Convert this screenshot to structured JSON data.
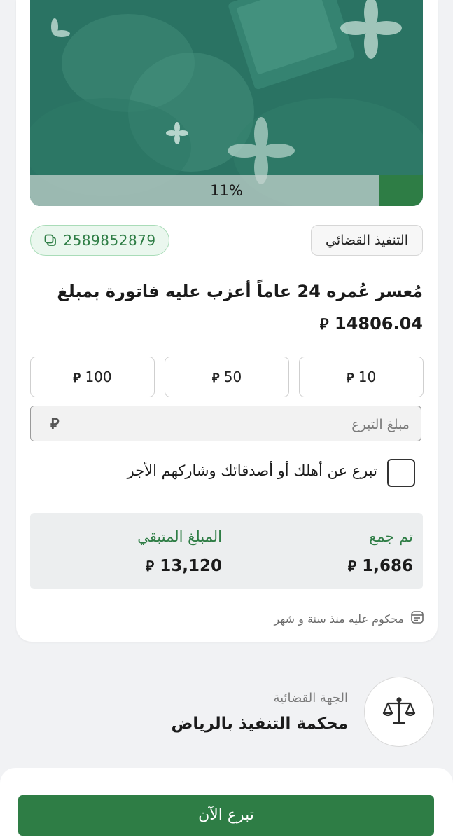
{
  "hero": {
    "progress_percent": 11,
    "progress_label": "11%"
  },
  "case": {
    "category": "التنفيذ القضائي",
    "id": "2589852879",
    "title": "مُعسر عُمره 24 عاماً أعزب عليه فاتورة بمبلغ",
    "amount": "14806.04",
    "currency_symbol": "⃁"
  },
  "quick_amounts": [
    {
      "label": "10"
    },
    {
      "label": "50"
    },
    {
      "label": "100"
    }
  ],
  "donation_input": {
    "placeholder": "مبلغ التبرع"
  },
  "gift_option": {
    "label": "تبرع عن أهلك أو أصدقائك وشاركهم الأجر",
    "checked": false
  },
  "stats": {
    "collected_label": "تم جمع",
    "collected_value": "1,686",
    "remaining_label": "المبلغ المتبقي",
    "remaining_value": "13,120"
  },
  "meta": {
    "sentence_text": "محكوم عليه منذ سنة و شهر",
    "icon": "document-icon"
  },
  "authority": {
    "caption": "الجهة القضائية",
    "name": "محكمة التنفيذ بالرياض",
    "icon": "scales-icon"
  },
  "cta": {
    "label": "تبرع الآن"
  },
  "colors": {
    "primary_green": "#2e7d45",
    "hero_teal": "#1f6b5a",
    "stats_bg": "#eceeef"
  }
}
